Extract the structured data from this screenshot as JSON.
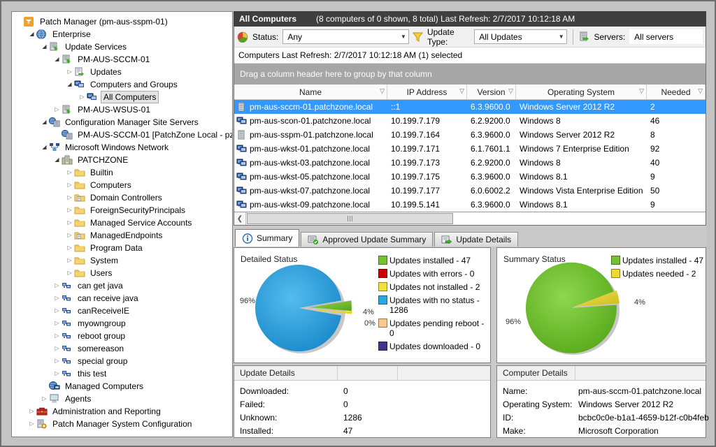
{
  "window": {
    "app": "Patch Manager"
  },
  "sidebar": {
    "items": [
      {
        "label": "Patch Manager (pm-aus-sspm-01)",
        "level": 0,
        "state": "none",
        "icon": "patch-manager-icon",
        "selected": false
      },
      {
        "label": "Enterprise",
        "level": 1,
        "state": "expanded",
        "icon": "globe-icon",
        "selected": false
      },
      {
        "label": "Update Services",
        "level": 2,
        "state": "expanded",
        "icon": "update-server-icon",
        "selected": false
      },
      {
        "label": "PM-AUS-SCCM-01",
        "level": 3,
        "state": "expanded",
        "icon": "update-server-icon",
        "selected": false
      },
      {
        "label": "Updates",
        "level": 4,
        "state": "collapsed",
        "icon": "updates-icon",
        "selected": false
      },
      {
        "label": "Computers and Groups",
        "level": 4,
        "state": "expanded",
        "icon": "computers-group-icon",
        "selected": false
      },
      {
        "label": "All Computers",
        "level": 5,
        "state": "collapsed",
        "icon": "computers-group-icon",
        "selected": true
      },
      {
        "label": "PM-AUS-WSUS-01",
        "level": 3,
        "state": "collapsed",
        "icon": "update-server-icon",
        "selected": false
      },
      {
        "label": "Configuration Manager Site Servers",
        "level": 2,
        "state": "expanded",
        "icon": "site-servers-icon",
        "selected": false
      },
      {
        "label": "PM-AUS-SCCM-01 [PatchZone Local - pz",
        "level": 3,
        "state": "none",
        "icon": "site-servers-icon",
        "selected": false
      },
      {
        "label": "Microsoft Windows Network",
        "level": 2,
        "state": "expanded",
        "icon": "network-icon",
        "selected": false
      },
      {
        "label": "PATCHZONE",
        "level": 3,
        "state": "expanded",
        "icon": "domain-icon",
        "selected": false
      },
      {
        "label": "Builtin",
        "level": 4,
        "state": "collapsed",
        "icon": "folder-icon",
        "selected": false
      },
      {
        "label": "Computers",
        "level": 4,
        "state": "collapsed",
        "icon": "folder-icon",
        "selected": false
      },
      {
        "label": "Domain Controllers",
        "level": 4,
        "state": "collapsed",
        "icon": "folder-doc-icon",
        "selected": false
      },
      {
        "label": "ForeignSecurityPrincipals",
        "level": 4,
        "state": "collapsed",
        "icon": "folder-icon",
        "selected": false
      },
      {
        "label": "Managed Service Accounts",
        "level": 4,
        "state": "collapsed",
        "icon": "folder-icon",
        "selected": false
      },
      {
        "label": "ManagedEndpoints",
        "level": 4,
        "state": "collapsed",
        "icon": "folder-doc-icon",
        "selected": false
      },
      {
        "label": "Program Data",
        "level": 4,
        "state": "collapsed",
        "icon": "folder-icon",
        "selected": false
      },
      {
        "label": "System",
        "level": 4,
        "state": "collapsed",
        "icon": "folder-icon",
        "selected": false
      },
      {
        "label": "Users",
        "level": 4,
        "state": "collapsed",
        "icon": "folder-icon",
        "selected": false
      },
      {
        "label": "can get java",
        "level": 3,
        "state": "collapsed",
        "icon": "group-icon",
        "selected": false
      },
      {
        "label": "can receive java",
        "level": 3,
        "state": "collapsed",
        "icon": "group-icon",
        "selected": false
      },
      {
        "label": "canReceiveIE",
        "level": 3,
        "state": "collapsed",
        "icon": "group-icon",
        "selected": false
      },
      {
        "label": "myowngroup",
        "level": 3,
        "state": "collapsed",
        "icon": "group-icon",
        "selected": false
      },
      {
        "label": "reboot group",
        "level": 3,
        "state": "collapsed",
        "icon": "group-icon",
        "selected": false
      },
      {
        "label": "somereason",
        "level": 3,
        "state": "collapsed",
        "icon": "group-icon",
        "selected": false
      },
      {
        "label": "special group",
        "level": 3,
        "state": "collapsed",
        "icon": "group-icon",
        "selected": false
      },
      {
        "label": "this test",
        "level": 3,
        "state": "collapsed",
        "icon": "group-icon",
        "selected": false
      },
      {
        "label": "Managed Computers",
        "level": 2,
        "state": "none",
        "icon": "managed-computers-icon",
        "selected": false
      },
      {
        "label": "Agents",
        "level": 2,
        "state": "collapsed",
        "icon": "agents-icon",
        "selected": false
      },
      {
        "label": "Administration and Reporting",
        "level": 1,
        "state": "collapsed",
        "icon": "toolbox-icon",
        "selected": false
      },
      {
        "label": "Patch Manager System Configuration",
        "level": 1,
        "state": "collapsed",
        "icon": "sysconfig-icon",
        "selected": false
      }
    ]
  },
  "header": {
    "title": "All Computers",
    "subtitle": "(8 computers of 0 shown, 8 total) Last Refresh: 2/7/2017 10:12:18 AM"
  },
  "filters": {
    "status_label": "Status:",
    "status_value": "Any",
    "update_type_label": "Update Type:",
    "update_type_value": "All Updates",
    "servers_label": "Servers:",
    "servers_value": "All servers"
  },
  "refresh_line": "Computers Last Refresh: 2/7/2017 10:12:18 AM  (1) selected",
  "groupby_hint": "Drag a column header here to group by that column",
  "grid": {
    "columns": [
      "Name",
      "IP Address",
      "Version",
      "Operating System",
      "Needed"
    ],
    "rows": [
      {
        "icon": "server-icon",
        "name": "pm-aus-sccm-01.patchzone.local",
        "ip": "::1",
        "version": "6.3.9600.0",
        "os": "Windows Server 2012 R2",
        "needed": "2",
        "selected": true
      },
      {
        "icon": "workstation-icon",
        "name": "pm-aus-scon-01.patchzone.local",
        "ip": "10.199.7.179",
        "version": "6.2.9200.0",
        "os": "Windows 8",
        "needed": "46",
        "selected": false
      },
      {
        "icon": "server-icon",
        "name": "pm-aus-sspm-01.patchzone.local",
        "ip": "10.199.7.164",
        "version": "6.3.9600.0",
        "os": "Windows Server 2012 R2",
        "needed": "8",
        "selected": false
      },
      {
        "icon": "workstation-icon",
        "name": "pm-aus-wkst-01.patchzone.local",
        "ip": "10.199.7.171",
        "version": "6.1.7601.1",
        "os": "Windows 7 Enterprise Edition",
        "needed": "92",
        "selected": false
      },
      {
        "icon": "workstation-icon",
        "name": "pm-aus-wkst-03.patchzone.local",
        "ip": "10.199.7.173",
        "version": "6.2.9200.0",
        "os": "Windows 8",
        "needed": "40",
        "selected": false
      },
      {
        "icon": "workstation-icon",
        "name": "pm-aus-wkst-05.patchzone.local",
        "ip": "10.199.7.175",
        "version": "6.3.9600.0",
        "os": "Windows 8.1",
        "needed": "9",
        "selected": false
      },
      {
        "icon": "workstation-icon",
        "name": "pm-aus-wkst-07.patchzone.local",
        "ip": "10.199.7.177",
        "version": "6.0.6002.2",
        "os": "Windows Vista Enterprise Edition",
        "needed": "50",
        "selected": false
      },
      {
        "icon": "workstation-icon",
        "name": "pm-aus-wkst-09.patchzone.local",
        "ip": "10.199.5.141",
        "version": "6.3.9600.0",
        "os": "Windows 8.1",
        "needed": "9",
        "selected": false
      }
    ]
  },
  "tabs": [
    {
      "label": "Summary",
      "icon": "info-icon",
      "active": true
    },
    {
      "label": "Approved Update Summary",
      "icon": "approved-summary-icon",
      "active": false
    },
    {
      "label": "Update Details",
      "icon": "update-details-icon",
      "active": false
    }
  ],
  "chart_data": [
    {
      "type": "pie",
      "title": "Detailed Status",
      "slices": [
        {
          "label": "Updates installed",
          "value": 47,
          "color": "#76c132"
        },
        {
          "label": "Updates with errors",
          "value": 0,
          "color": "#cc0000"
        },
        {
          "label": "Updates not installed",
          "value": 2,
          "color": "#f0e13a"
        },
        {
          "label": "Updates with no status",
          "value": 1286,
          "color": "#28a8e0"
        },
        {
          "label": "Updates pending reboot",
          "value": 0,
          "color": "#f9c98c"
        },
        {
          "label": "Updates downloaded",
          "value": 0,
          "color": "#433488"
        }
      ],
      "annotations": [
        "96%",
        "4%",
        "0%"
      ],
      "legend_position": "right"
    },
    {
      "type": "pie",
      "title": "Summary Status",
      "slices": [
        {
          "label": "Updates installed",
          "value": 47,
          "color": "#76c132"
        },
        {
          "label": "Updates needed",
          "value": 2,
          "color": "#f0d830"
        }
      ],
      "annotations": [
        "96%",
        "4%"
      ],
      "legend_position": "right"
    }
  ],
  "update_details": {
    "title": "Update Details",
    "rows": [
      {
        "label": "Downloaded:",
        "value": "0"
      },
      {
        "label": "Failed:",
        "value": "0"
      },
      {
        "label": "Unknown:",
        "value": "1286"
      },
      {
        "label": "Installed:",
        "value": "47"
      }
    ]
  },
  "computer_details": {
    "title": "Computer Details",
    "rows": [
      {
        "label": "Name:",
        "value": "pm-aus-sccm-01.patchzone.local"
      },
      {
        "label": "Operating System:",
        "value": "Windows Server 2012 R2"
      },
      {
        "label": "ID:",
        "value": "bcbc0c0e-b1a1-4659-b12f-c0b4feb"
      },
      {
        "label": "Make:",
        "value": "Microsoft Corporation"
      }
    ]
  },
  "colors": {
    "selected_row": "#3399ff",
    "titlebar_bg": "#3f3f3f",
    "groupbar_bg": "#a6a6a6",
    "pie_blue": "#2399dc",
    "pie_green": "#68c42f",
    "pie_yellow": "#ecd92b"
  }
}
